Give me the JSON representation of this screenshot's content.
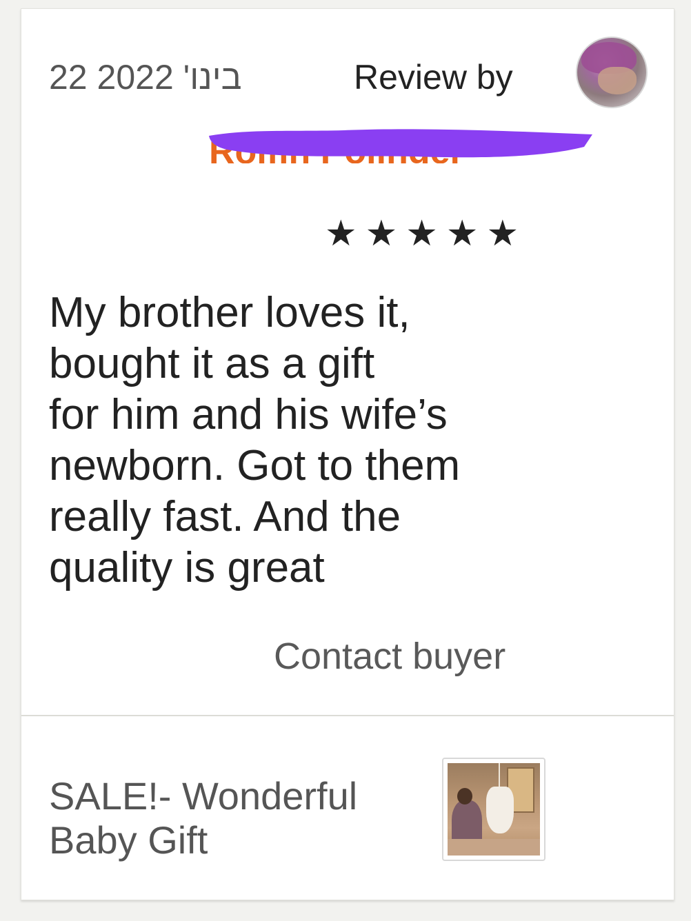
{
  "review": {
    "date": "22 בינו' 2022",
    "review_by_label": "Review by",
    "reviewer_name": "Rolfin Polinger",
    "rating": 5,
    "stars": [
      "★",
      "★",
      "★",
      "★",
      "★"
    ],
    "text": "My brother loves it,\nbought it as a gift\nfor him and his wife’s\nnewborn. Got to them\nreally fast. And the\nquality is great",
    "contact_buyer_label": "Contact buyer"
  },
  "listing": {
    "title": "SALE!- Wonderful\nBaby Gift"
  },
  "colors": {
    "reviewer_name": "#e8661e",
    "redaction": "#8a3ff2",
    "text": "#222222",
    "muted": "#555555"
  },
  "icons": {
    "avatar": "reviewer-avatar",
    "star": "star-icon",
    "thumbnail": "listing-thumbnail"
  }
}
